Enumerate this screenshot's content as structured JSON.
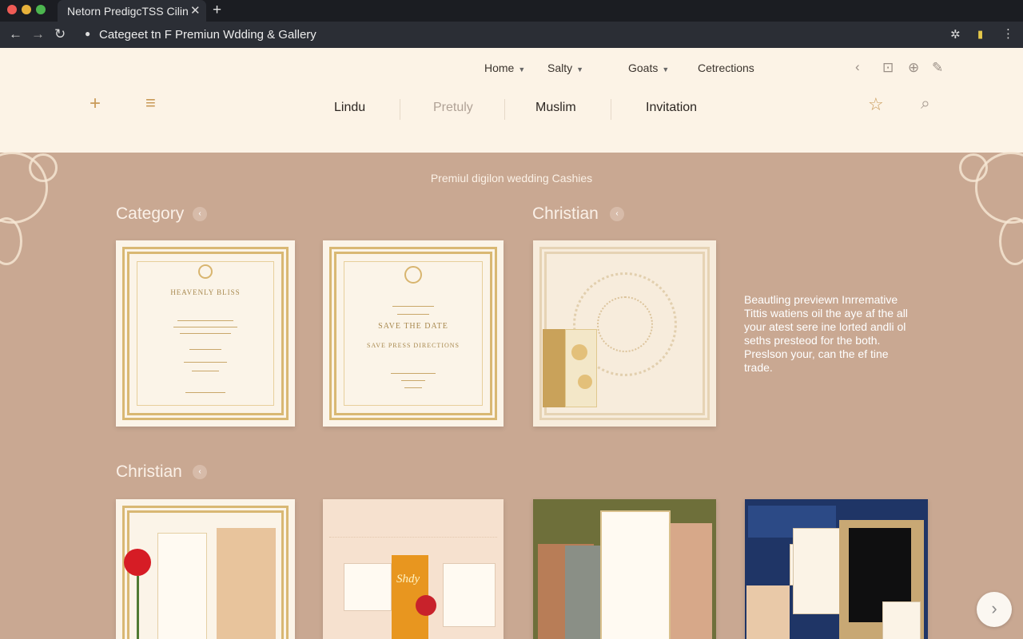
{
  "browser": {
    "tab_title": "Netorn PredigcTSS Cilin",
    "tab_close": "✕",
    "new_tab": "+",
    "url": "Categeet tn F Premiun Wdding & Gallery"
  },
  "header": {
    "top_nav": [
      "Home",
      "Salty",
      "Goats",
      "Cetrections"
    ],
    "category_tabs": [
      "Lindu",
      "Pretuly",
      "Muslim",
      "Invitation"
    ]
  },
  "main": {
    "tagline": "Premiul digilon wedding Cashies",
    "sections": [
      {
        "title": "Category"
      },
      {
        "title": "Christian"
      },
      {
        "title": "Christian"
      }
    ],
    "cards_row1": [
      {
        "title": "HEAVENLY BLISS",
        "kind": "invitation"
      },
      {
        "title": "SAVE THE DATE",
        "subtitle": "SAVE PRESS DIRECTIONS",
        "kind": "save-the-date"
      },
      {
        "title": "",
        "kind": "pattern"
      }
    ],
    "side_description": [
      "Beautling previewn Inrremative",
      "Tittis watiens oil the aye af the all",
      "your atest sere ine lorted andli ol",
      "seths presteod for the both.",
      "Preslson your, can the ef tine",
      "trade."
    ],
    "card4_script": "Shdy"
  },
  "colors": {
    "page_bg": "#c9a892",
    "header_bg": "#fcf3e6",
    "accent_gold": "#c99a58",
    "browser_dark": "#1b1d22"
  }
}
